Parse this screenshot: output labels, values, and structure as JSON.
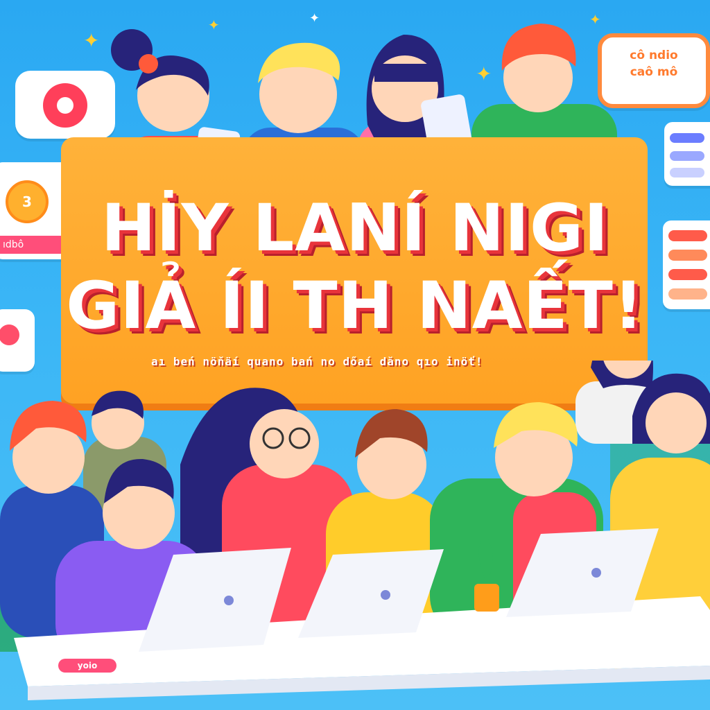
{
  "banner": {
    "headline_line1": "HİY LAΝÍ NIGI",
    "headline_line2": "GIẢ ÍI TH NAẾT!",
    "subline": "aı beń nöňäí  quano bań no dőaí dăno qıo inöť!"
  },
  "bubble_top_right": {
    "line1": "cô ndio",
    "line2": "caô mô"
  },
  "card_left": {
    "coin_text": "3",
    "pill_text": "ıdbô"
  },
  "desk_label": "yoio",
  "colors": {
    "sky": "#2aa8f2",
    "banner": "#ffa223",
    "headline_shadow": "#e8343b",
    "bubble_border": "#ff8a3d",
    "accent_pink": "#ff4e7a"
  },
  "icons": [
    "record-icon",
    "coin-icon",
    "sparkle-icon",
    "laptop-icon",
    "tablet-icon",
    "plant-icon"
  ]
}
